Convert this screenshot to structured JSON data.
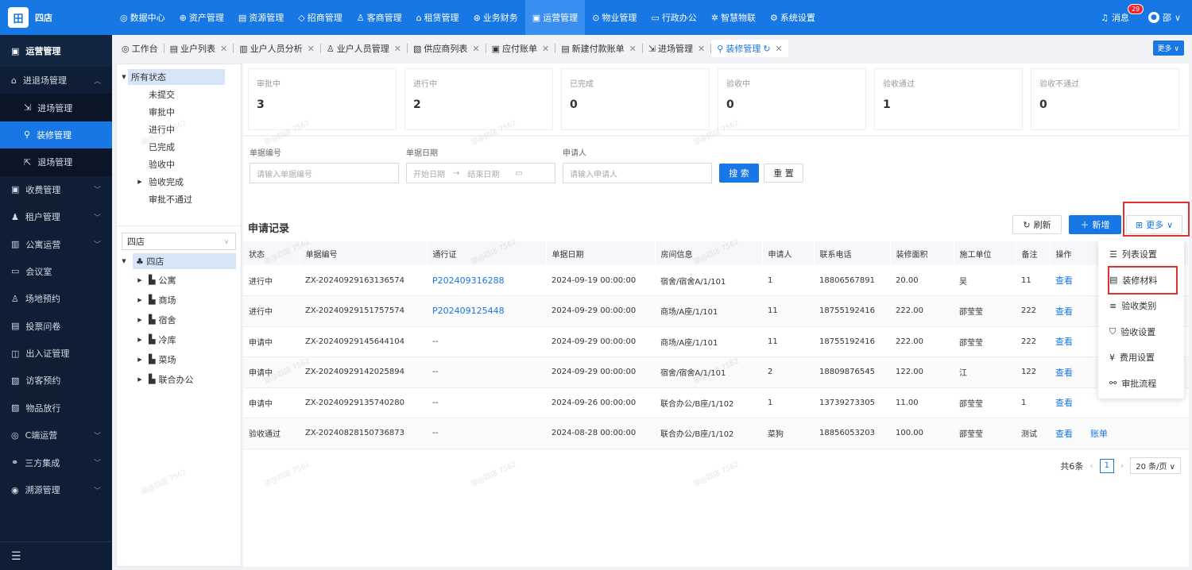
{
  "app": {
    "name": "四店",
    "logo_char": "田"
  },
  "topnav": [
    {
      "icon": "◎",
      "label": "数据中心"
    },
    {
      "icon": "⊕",
      "label": "资产管理"
    },
    {
      "icon": "▤",
      "label": "资源管理"
    },
    {
      "icon": "◇",
      "label": "招商管理"
    },
    {
      "icon": "♙",
      "label": "客商管理"
    },
    {
      "icon": "⌂",
      "label": "租赁管理"
    },
    {
      "icon": "⊛",
      "label": "业务财务"
    },
    {
      "icon": "▣",
      "label": "运营管理"
    },
    {
      "icon": "⊙",
      "label": "物业管理"
    },
    {
      "icon": "▭",
      "label": "行政办公"
    },
    {
      "icon": "✲",
      "label": "智慧物联"
    },
    {
      "icon": "⚙",
      "label": "系统设置"
    }
  ],
  "header_right": {
    "message_label": "消息",
    "message_count": "29",
    "user_name": "邵"
  },
  "sidebar": {
    "title": "运营管理",
    "items": [
      {
        "icon": "⌂",
        "label": "进退场管理",
        "chev": "^"
      },
      {
        "icon": "⇲",
        "label": "进场管理"
      },
      {
        "icon": "⚲",
        "label": "装修管理"
      },
      {
        "icon": "⇱",
        "label": "退场管理"
      },
      {
        "icon": "▣",
        "label": "收费管理",
        "chev": "v"
      },
      {
        "icon": "♟",
        "label": "租户管理",
        "chev": "v"
      },
      {
        "icon": "▥",
        "label": "公寓运营",
        "chev": "v"
      },
      {
        "icon": "▭",
        "label": "会议室"
      },
      {
        "icon": "♙",
        "label": "场地预约"
      },
      {
        "icon": "▤",
        "label": "投票问卷"
      },
      {
        "icon": "◫",
        "label": "出入证管理"
      },
      {
        "icon": "▧",
        "label": "访客预约"
      },
      {
        "icon": "▨",
        "label": "物品放行"
      },
      {
        "icon": "◎",
        "label": "C端运营",
        "chev": "v"
      },
      {
        "icon": "⚭",
        "label": "三方集成",
        "chev": "v"
      },
      {
        "icon": "◉",
        "label": "溯源管理",
        "chev": "v"
      }
    ],
    "collapse_icon": "☰"
  },
  "tabs": [
    {
      "icon": "◎",
      "label": "工作台"
    },
    {
      "icon": "▤",
      "label": "业户列表"
    },
    {
      "icon": "▥",
      "label": "业户人员分析"
    },
    {
      "icon": "♙",
      "label": "业户人员管理"
    },
    {
      "icon": "▧",
      "label": "供应商列表"
    },
    {
      "icon": "▣",
      "label": "应付账单"
    },
    {
      "icon": "▤",
      "label": "新建付款账单"
    },
    {
      "icon": "⇲",
      "label": "进场管理"
    },
    {
      "icon": "⚲",
      "label": "装修管理"
    }
  ],
  "tabs_more": "更多 ∨",
  "status_tree": {
    "root": "所有状态",
    "items": [
      "未提交",
      "审批中",
      "进行中",
      "已完成",
      "验收中",
      "验收完成",
      "审批不通过"
    ]
  },
  "store_select": "四店",
  "store_tree": {
    "root": "四店",
    "children": [
      "公寓",
      "商场",
      "宿舍",
      "冷库",
      "菜场",
      "联合办公"
    ]
  },
  "stats": [
    {
      "title": "审批中",
      "value": "3"
    },
    {
      "title": "进行中",
      "value": "2"
    },
    {
      "title": "已完成",
      "value": "0"
    },
    {
      "title": "验收中",
      "value": "0"
    },
    {
      "title": "验收通过",
      "value": "1"
    },
    {
      "title": "验收不通过",
      "value": "0"
    }
  ],
  "filters": {
    "doc_no_label": "单据编号",
    "doc_no_placeholder": "请输入单据编号",
    "date_label": "单据日期",
    "date_start": "开始日期",
    "date_arrow": "→",
    "date_end": "结束日期",
    "applicant_label": "申请人",
    "applicant_placeholder": "请输入申请人",
    "search": "搜 索",
    "reset": "重 置"
  },
  "records": {
    "title": "申请记录",
    "refresh": "刷新",
    "add": "新增",
    "more": "更多",
    "columns": [
      "状态",
      "单据编号",
      "通行证",
      "单据日期",
      "房间信息",
      "申请人",
      "联系电话",
      "装修面积",
      "施工单位",
      "备注",
      "操作"
    ],
    "rows": [
      [
        "进行中",
        "ZX-20240929163136574",
        "P202409316288",
        "2024-09-19 00:00:00",
        "宿舍/宿舍A/1/101",
        "1",
        "18806567891",
        "20.00",
        "吴",
        "11",
        "查看",
        ""
      ],
      [
        "进行中",
        "ZX-20240929151757574",
        "P202409125448",
        "2024-09-29 00:00:00",
        "商场/A座/1/101",
        "11",
        "18755192416",
        "222.00",
        "邵莹莹",
        "222",
        "查看",
        ""
      ],
      [
        "申请中",
        "ZX-20240929145644104",
        "--",
        "2024-09-29 00:00:00",
        "商场/A座/1/101",
        "11",
        "18755192416",
        "222.00",
        "邵莹莹",
        "222",
        "查看",
        ""
      ],
      [
        "申请中",
        "ZX-20240929142025894",
        "--",
        "2024-09-29 00:00:00",
        "宿舍/宿舍A/1/101",
        "2",
        "18809876545",
        "122.00",
        "江",
        "122",
        "查看",
        ""
      ],
      [
        "申请中",
        "ZX-20240929135740280",
        "--",
        "2024-09-26 00:00:00",
        "联合办公/B座/1/102",
        "1",
        "13739273305",
        "11.00",
        "邵莹莹",
        "1",
        "查看",
        ""
      ],
      [
        "验收通过",
        "ZX-20240828150736873",
        "--",
        "2024-08-28 00:00:00",
        "联合办公/B座/1/102",
        "菜狗",
        "18856053203",
        "100.00",
        "邵莹莹",
        "测试",
        "查看",
        "账单"
      ]
    ]
  },
  "pagination": {
    "total": "共6条",
    "page": "1",
    "size": "20 条/页"
  },
  "dropdown": [
    {
      "icon": "☰",
      "label": "列表设置"
    },
    {
      "icon": "▤",
      "label": "装修材料"
    },
    {
      "icon": "≡",
      "label": "验收类别"
    },
    {
      "icon": "⛉",
      "label": "验收设置"
    },
    {
      "icon": "¥",
      "label": "费用设置"
    },
    {
      "icon": "⚯",
      "label": "审批流程"
    }
  ],
  "watermark": "邵@四店 7562",
  "colors": {
    "primary": "#1677e5",
    "sidebar": "#0f1e35",
    "highlight": "#e03030"
  }
}
